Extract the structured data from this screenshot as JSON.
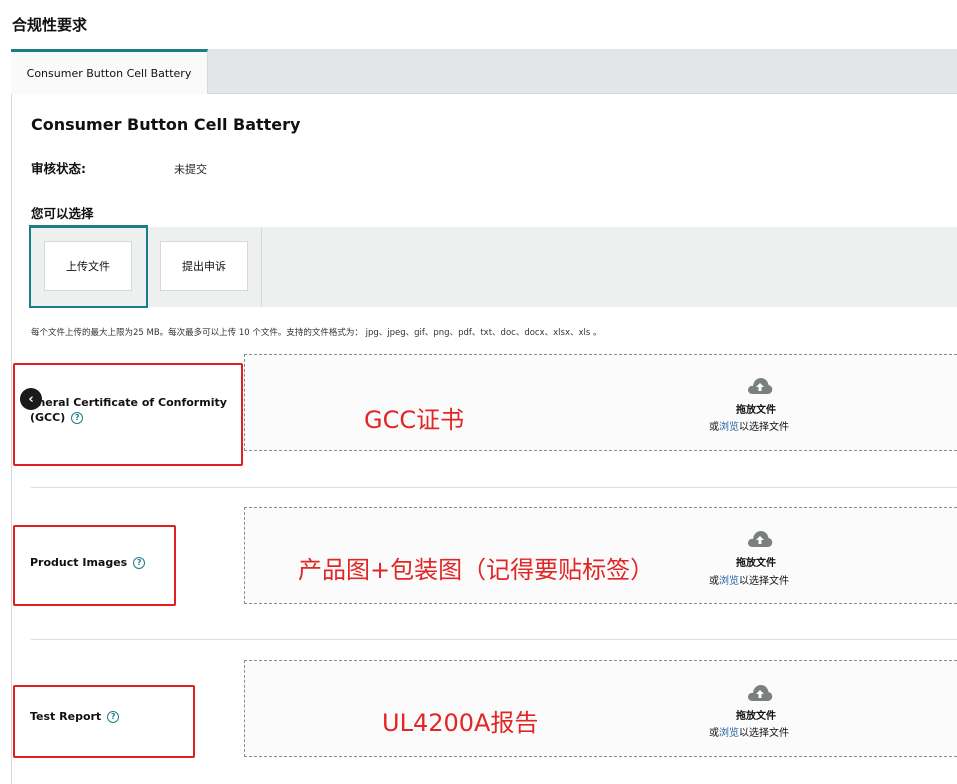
{
  "page": {
    "title": "合规性要求"
  },
  "tabs": [
    {
      "label": "Consumer Button Cell Battery"
    }
  ],
  "card": {
    "title": "Consumer Button Cell Battery",
    "status_label": "审核状态:",
    "status_value": "未提交",
    "choose_label": "您可以选择",
    "choices": [
      {
        "label": "上传文件"
      },
      {
        "label": "提出申诉"
      }
    ],
    "hint": "每个文件上传的最大上限为25 MB。每次最多可以上传 10 个文件。支持的文件格式为： jpg、jpeg、gif、png、pdf、txt、doc、docx、xlsx、xls 。"
  },
  "upload": {
    "drop_title": "拖放文件",
    "drop_prefix": "或",
    "drop_link": "浏览",
    "drop_suffix": "以选择文件"
  },
  "fields": [
    {
      "label_line1": "eneral Certificate of Conformity",
      "label_line2": "(GCC)",
      "annotation": "GCC证书"
    },
    {
      "label": "Product Images",
      "annotation": "产品图+包装图（记得要贴标签）"
    },
    {
      "label": "Test Report",
      "annotation": "UL4200A报告"
    }
  ],
  "icons": {
    "help": "?",
    "back": "‹",
    "cloud": "cloud-upload-icon"
  },
  "colors": {
    "accent": "#1d7d85",
    "link": "#2162a1",
    "annotation_red": "#e32525"
  }
}
